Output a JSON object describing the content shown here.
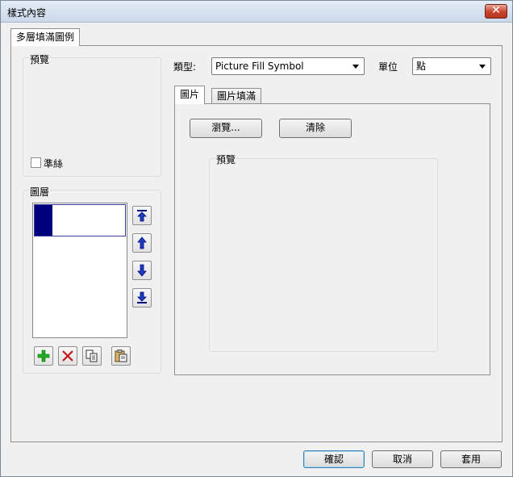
{
  "window": {
    "title": "樣式內容",
    "close_glyph": "✕"
  },
  "main_tab": "多層填滿圖例",
  "preview_group": {
    "label": "預覽"
  },
  "draft": {
    "label": "準絲",
    "checked": false
  },
  "layers_group": {
    "label": "圖層"
  },
  "type": {
    "label": "類型:",
    "value": "Picture Fill Symbol"
  },
  "unit": {
    "label": "單位",
    "value": "點"
  },
  "inner_tabs": [
    "圖片",
    "圖片填滿"
  ],
  "browse_label": "瀏覽...",
  "clear_label": "清除",
  "picture_preview_label": "預覽",
  "footer": {
    "ok": "確認",
    "cancel": "取消",
    "apply": "套用"
  },
  "colors": {
    "layer_swatch": "#00007f",
    "accent": "#3c7fb1"
  },
  "icons": [
    "move-to-top-icon",
    "move-up-icon",
    "move-down-icon",
    "move-to-bottom-icon",
    "add-layer-icon",
    "delete-layer-icon",
    "copy-layer-icon",
    "paste-layer-icon"
  ]
}
